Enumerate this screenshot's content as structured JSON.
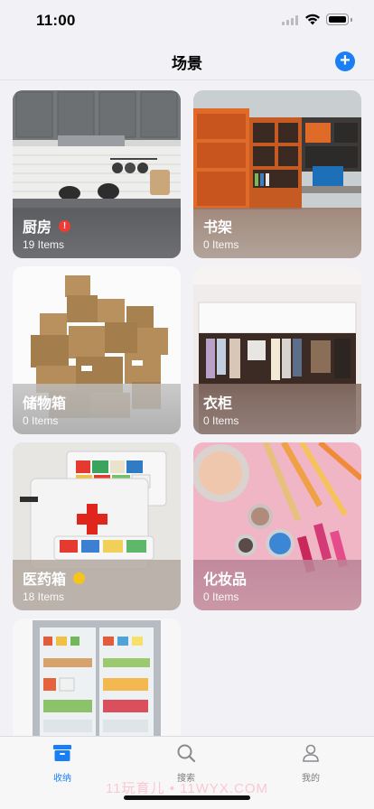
{
  "status": {
    "time": "11:00"
  },
  "nav": {
    "title": "场景",
    "add_label": "+"
  },
  "scenes": [
    {
      "name": "厨房",
      "count": "19 Items",
      "badge": "!"
    },
    {
      "name": "书架",
      "count": "0 Items"
    },
    {
      "name": "储物箱",
      "count": "0 Items"
    },
    {
      "name": "衣柜",
      "count": "0 Items"
    },
    {
      "name": "医药箱",
      "count": "18 Items"
    },
    {
      "name": "化妆品",
      "count": "0 Items"
    }
  ],
  "tabs": [
    {
      "label": "收纳",
      "icon": "storage-box-icon",
      "active": true
    },
    {
      "label": "搜索",
      "icon": "search-icon",
      "active": false
    },
    {
      "label": "我的",
      "icon": "person-icon",
      "active": false
    }
  ],
  "watermark": "11玩育儿 • 11WYX.COM",
  "colors": {
    "accent": "#1a7ff5",
    "alert": "#f03a33",
    "warning": "#f7c41b"
  }
}
